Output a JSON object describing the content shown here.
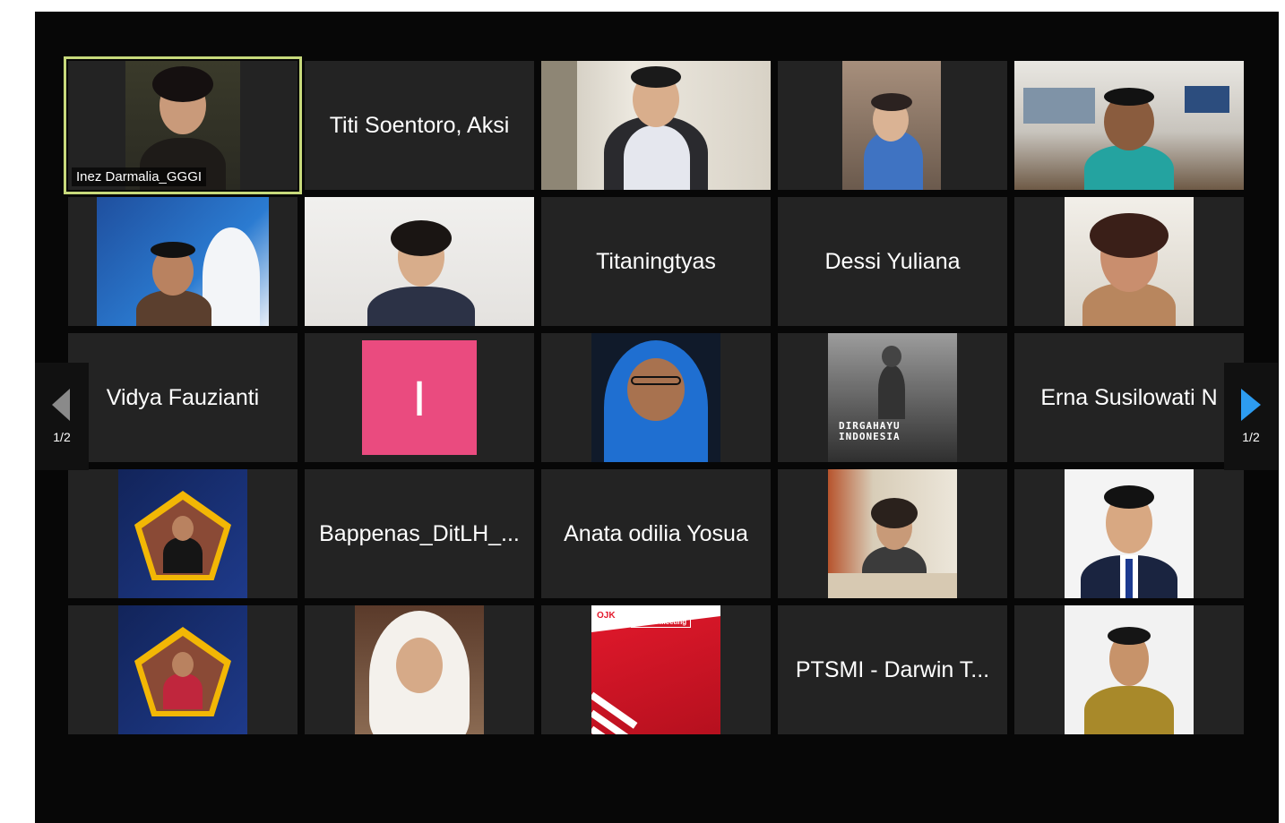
{
  "participants": [
    {
      "name": "Inez Darmalia_GGGI",
      "video": true
    },
    {
      "name": "Titi Soentoro, Aksi",
      "video": false
    },
    {
      "name": "",
      "video": true
    },
    {
      "name": "",
      "video": true
    },
    {
      "name": "",
      "video": true
    },
    {
      "name": "",
      "video": true
    },
    {
      "name": "",
      "video": true
    },
    {
      "name": "Titaningtyas",
      "video": false
    },
    {
      "name": "Dessi Yuliana",
      "video": false
    },
    {
      "name": "",
      "video": true
    },
    {
      "name": "Vidya Fauzianti",
      "video": false
    },
    {
      "name": "",
      "avatar_letter": "I",
      "video": false
    },
    {
      "name": "",
      "video": true
    },
    {
      "name": "",
      "video": true
    },
    {
      "name": "Erna Susilowati N",
      "video": false
    },
    {
      "name": "",
      "video": true
    },
    {
      "name": "Bappenas_DitLH_...",
      "video": false
    },
    {
      "name": "Anata odilia Yosua",
      "video": false
    },
    {
      "name": "",
      "video": true
    },
    {
      "name": "",
      "video": true
    },
    {
      "name": "",
      "video": true
    },
    {
      "name": "",
      "video": true
    },
    {
      "name": "",
      "video": true
    },
    {
      "name": "PTSMI - Darwin T...",
      "video": false
    },
    {
      "name": "",
      "video": true
    }
  ],
  "overlays": {
    "dirgahayu_line1": "DIRGAHAYU",
    "dirgahayu_line2": "INDONESIA",
    "virtual_meeting": "Virtual Meeting",
    "ojk_logo": "OJK"
  },
  "pagination": {
    "left_label": "1/2",
    "right_label": "1/2"
  },
  "colors": {
    "stage_bg": "#070707",
    "tile_bg": "#232323",
    "active_border": "#c7d97b",
    "avatar_pink": "#ea4b7f",
    "next_arrow": "#2d9cf0",
    "prev_arrow": "#8a8a8a"
  }
}
